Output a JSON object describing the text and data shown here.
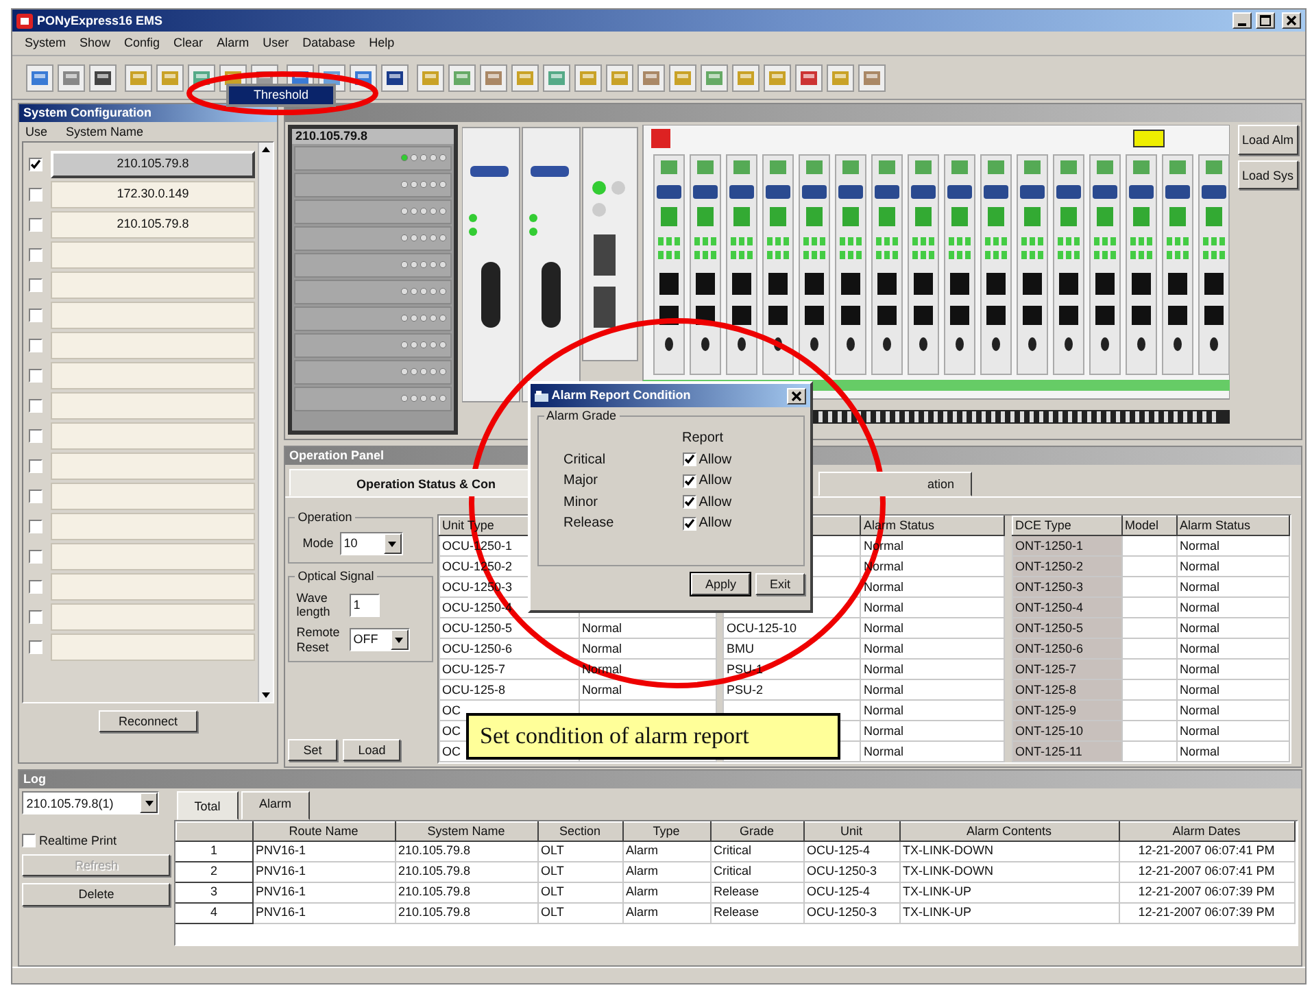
{
  "window": {
    "title": "PONyExpress16 EMS"
  },
  "menu": [
    "System",
    "Show",
    "Config",
    "Clear",
    "Alarm",
    "User",
    "Database",
    "Help"
  ],
  "alarm_menu": {
    "items": [
      {
        "label": "Threshold",
        "selected": true
      }
    ]
  },
  "system_configuration": {
    "title": "System Configuration",
    "columns": [
      "Use",
      "System Name"
    ],
    "rows": [
      {
        "checked": true,
        "selected": true,
        "name": "210.105.79.8"
      },
      {
        "checked": false,
        "selected": false,
        "name": "172.30.0.149"
      },
      {
        "checked": false,
        "selected": false,
        "name": "210.105.79.8"
      },
      {
        "checked": false,
        "selected": false
      },
      {
        "checked": false,
        "selected": false
      },
      {
        "checked": false,
        "selected": false
      },
      {
        "checked": false,
        "selected": false
      },
      {
        "checked": false,
        "selected": false
      },
      {
        "checked": false,
        "selected": false
      },
      {
        "checked": false,
        "selected": false
      },
      {
        "checked": false,
        "selected": false
      },
      {
        "checked": false,
        "selected": false
      },
      {
        "checked": false,
        "selected": false
      },
      {
        "checked": false,
        "selected": false
      },
      {
        "checked": false,
        "selected": false
      },
      {
        "checked": false,
        "selected": false
      },
      {
        "checked": false,
        "selected": false
      }
    ],
    "button": "Reconnect"
  },
  "rack": {
    "system_name": "210.105.79.8",
    "buttons": [
      "Load Alm",
      "Load Sys"
    ]
  },
  "operation_panel": {
    "title": "Operation Panel",
    "tabs": [
      {
        "label": "Operation Status & Con",
        "selected": true
      },
      {
        "label": "ation",
        "selected": false
      }
    ],
    "operation_group": "Operation",
    "mode_label": "Mode",
    "mode_value": "10",
    "optical_group": "Optical Signal",
    "wave_label": "Wave length",
    "wave_value": "1",
    "reset_label": "Remote Reset",
    "reset_value": "OFF",
    "buttons": [
      "Set",
      "Load"
    ],
    "unit_table": {
      "columns": [
        "Unit Type"
      ],
      "rows": [
        [
          "OCU-1250-1"
        ],
        [
          "OCU-1250-2"
        ],
        [
          "OCU-1250-3"
        ],
        [
          "OCU-1250-4"
        ],
        [
          "OCU-1250-5",
          "Normal"
        ],
        [
          "OCU-1250-6",
          "Normal"
        ],
        [
          "OCU-125-7",
          "Normal"
        ],
        [
          "OCU-125-8",
          "Normal"
        ],
        [
          "OC"
        ],
        [
          "OC"
        ],
        [
          "OC"
        ]
      ]
    },
    "unit_table_2": {
      "columns": [
        "",
        "Alarm Status"
      ],
      "rows": [
        [
          "",
          "Normal"
        ],
        [
          "",
          "Normal"
        ],
        [
          "",
          "Normal"
        ],
        [
          "",
          "Normal"
        ],
        [
          "OCU-125-10",
          "Normal"
        ],
        [
          "BMU",
          "Normal"
        ],
        [
          "PSU-1",
          "Normal"
        ],
        [
          "PSU-2",
          "Normal"
        ],
        [
          "",
          "Normal"
        ],
        [
          "",
          "Normal"
        ],
        [
          "",
          "Normal"
        ]
      ]
    },
    "dce_table": {
      "columns": [
        "DCE Type",
        "Model",
        "Alarm Status"
      ],
      "rows": [
        [
          "ONT-1250-1",
          "",
          "Normal"
        ],
        [
          "ONT-1250-2",
          "",
          "Normal"
        ],
        [
          "ONT-1250-3",
          "",
          "Normal"
        ],
        [
          "ONT-1250-4",
          "",
          "Normal"
        ],
        [
          "ONT-1250-5",
          "",
          "Normal"
        ],
        [
          "ONT-1250-6",
          "",
          "Normal"
        ],
        [
          "ONT-125-7",
          "",
          "Normal"
        ],
        [
          "ONT-125-8",
          "",
          "Normal"
        ],
        [
          "ONT-125-9",
          "",
          "Normal"
        ],
        [
          "ONT-125-10",
          "",
          "Normal"
        ],
        [
          "ONT-125-11",
          "",
          "Normal"
        ]
      ]
    }
  },
  "dialog": {
    "title": "Alarm Report Condition",
    "group": "Alarm Grade",
    "column": "Report",
    "grades": [
      {
        "label": "Critical",
        "option": "Allow",
        "checked": true
      },
      {
        "label": "Major",
        "option": "Allow",
        "checked": true
      },
      {
        "label": "Minor",
        "option": "Allow",
        "checked": true
      },
      {
        "label": "Release",
        "option": "Allow",
        "checked": true
      }
    ],
    "buttons": [
      "Apply",
      "Exit"
    ]
  },
  "callout": "Set condition of alarm report",
  "log": {
    "title": "Log",
    "system": "210.105.79.8(1)",
    "realtime": {
      "label": "Realtime Print",
      "checked": false
    },
    "buttons": [
      {
        "label": "Refresh",
        "disabled": true
      },
      {
        "label": "Delete",
        "disabled": false
      }
    ],
    "tabs": [
      {
        "label": "Total",
        "selected": true
      },
      {
        "label": "Alarm",
        "selected": false
      }
    ],
    "columns": [
      "Route Name",
      "System Name",
      "Section",
      "Type",
      "Grade",
      "Unit",
      "Alarm Contents",
      "Alarm Dates"
    ],
    "rows": [
      {
        "index": "1",
        "cells": [
          "PNV16-1",
          "210.105.79.8",
          "OLT",
          "Alarm",
          "Critical",
          "OCU-125-4",
          "TX-LINK-DOWN",
          "12-21-2007 06:07:41 PM"
        ]
      },
      {
        "index": "2",
        "cells": [
          "PNV16-1",
          "210.105.79.8",
          "OLT",
          "Alarm",
          "Critical",
          "OCU-1250-3",
          "TX-LINK-DOWN",
          "12-21-2007 06:07:41 PM"
        ]
      },
      {
        "index": "3",
        "cells": [
          "PNV16-1",
          "210.105.79.8",
          "OLT",
          "Alarm",
          "Release",
          "OCU-125-4",
          "TX-LINK-UP",
          "12-21-2007 06:07:39 PM"
        ]
      },
      {
        "index": "4",
        "cells": [
          "PNV16-1",
          "210.105.79.8",
          "OLT",
          "Alarm",
          "Release",
          "OCU-1250-3",
          "TX-LINK-UP",
          "12-21-2007 06:07:39 PM"
        ]
      }
    ]
  }
}
